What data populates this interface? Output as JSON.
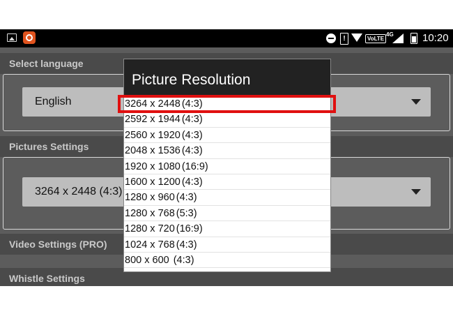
{
  "status_bar": {
    "icons": [
      "gallery-icon",
      "app-icon",
      "do-not-disturb-icon",
      "alert-icon",
      "wifi-icon",
      "volte-icon",
      "signal-icon",
      "battery-icon"
    ],
    "alert_glyph": "!",
    "volte_label": "VoLTE",
    "network_label": "4G",
    "time": "10:20"
  },
  "settings": {
    "language": {
      "header": "Select language",
      "value": "English"
    },
    "pictures": {
      "header": "Pictures Settings",
      "value": "3264 x 2448 (4:3)"
    },
    "video": {
      "header": "Video Settings (PRO)"
    },
    "whistle": {
      "header": "Whistle Settings"
    }
  },
  "dialog": {
    "title": "Picture Resolution",
    "selected_index": 0,
    "options": [
      {
        "size": "3264 x 2448",
        "ratio": "(4:3)"
      },
      {
        "size": "2592 x 1944",
        "ratio": "(4:3)"
      },
      {
        "size": "2560 x 1920",
        "ratio": "(4:3)"
      },
      {
        "size": "2048 x 1536",
        "ratio": "(4:3)"
      },
      {
        "size": "1920 x 1080",
        "ratio": "(16:9)"
      },
      {
        "size": "1600 x 1200",
        "ratio": "(4:3)"
      },
      {
        "size": "1280 x 960",
        "ratio": "(4:3)"
      },
      {
        "size": "1280 x 768",
        "ratio": "(5:3)"
      },
      {
        "size": "1280 x 720",
        "ratio": "(16:9)"
      },
      {
        "size": "1024 x 768",
        "ratio": "(4:3)"
      },
      {
        "size": "800 x 600",
        "ratio": " (4:3)"
      },
      {
        "size": "",
        "ratio": ""
      }
    ]
  },
  "colors": {
    "highlight": "#e01010",
    "dialog_title_bg": "#222222",
    "background": "#5c5c5c",
    "section_header_bg": "#4a4a4a"
  }
}
